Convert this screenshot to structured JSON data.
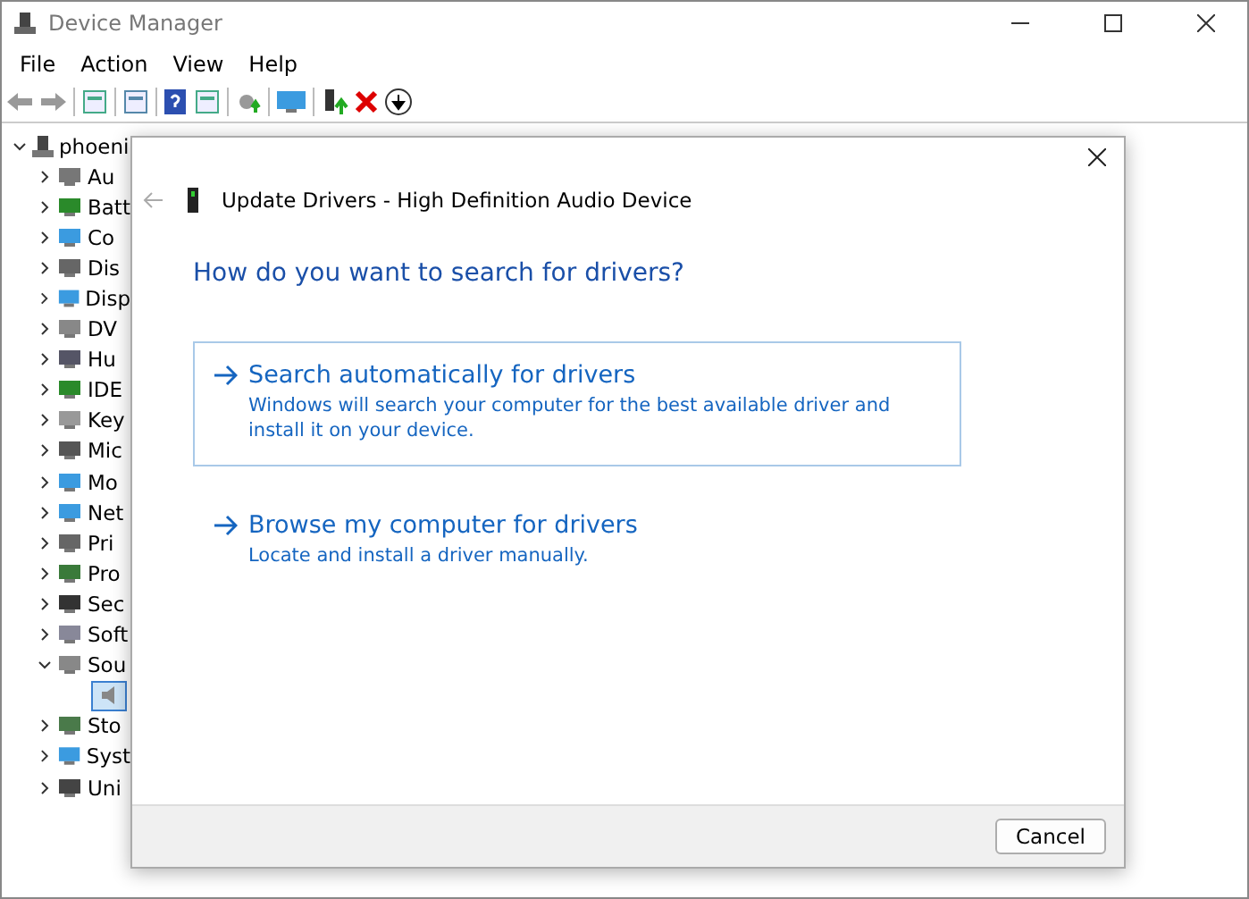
{
  "window": {
    "title": "Device Manager"
  },
  "menu": [
    "File",
    "Action",
    "View",
    "Help"
  ],
  "tree": {
    "label": "phoeni",
    "expanded": true,
    "children": [
      {
        "label": "Au",
        "expanded": false
      },
      {
        "label": "Batt",
        "expanded": false
      },
      {
        "label": "Co",
        "expanded": false
      },
      {
        "label": "Dis",
        "expanded": false
      },
      {
        "label": "Disp",
        "expanded": false
      },
      {
        "label": "DV",
        "expanded": false
      },
      {
        "label": "Hu",
        "expanded": false
      },
      {
        "label": "IDE",
        "expanded": false
      },
      {
        "label": "Key",
        "expanded": false
      },
      {
        "label": "Mic",
        "expanded": false
      },
      {
        "label": "Mo",
        "expanded": false
      },
      {
        "label": "Net",
        "expanded": false
      },
      {
        "label": "Pri",
        "expanded": false
      },
      {
        "label": "Pro",
        "expanded": false
      },
      {
        "label": "Sec",
        "expanded": false
      },
      {
        "label": "Soft",
        "expanded": false
      },
      {
        "label": "Sou",
        "expanded": true,
        "children": [
          {
            "selected": true
          }
        ]
      },
      {
        "label": "Sto",
        "expanded": false
      },
      {
        "label": "Syst",
        "expanded": false
      },
      {
        "label": "Uni",
        "expanded": false
      }
    ]
  },
  "dialog": {
    "title": "Update Drivers - High Definition Audio Device",
    "back_disabled": true,
    "heading": "How do you want to search for drivers?",
    "options": [
      {
        "title": "Search automatically for drivers",
        "description": "Windows will search your computer for the best available driver and install it on your device.",
        "selected": true
      },
      {
        "title": "Browse my computer for drivers",
        "description": "Locate and install a driver manually.",
        "selected": false
      }
    ],
    "buttons": [
      "Cancel"
    ]
  }
}
